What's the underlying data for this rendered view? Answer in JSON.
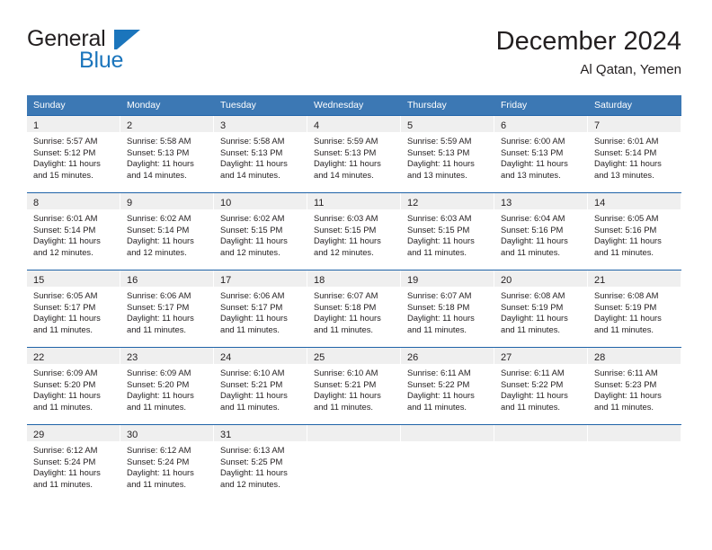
{
  "brand": {
    "name_top": "General",
    "name_bottom": "Blue",
    "accent_color": "#1b75bc",
    "triangle_icon": "brand-triangle-icon"
  },
  "header": {
    "title": "December 2024",
    "subtitle": "Al Qatan, Yemen"
  },
  "theme": {
    "header_row_bg": "#3c78b4",
    "header_row_text": "#ffffff",
    "week_rule": "#1f63a8",
    "daynum_band_bg": "#efefef",
    "body_text": "#231f20"
  },
  "calendar": {
    "weekday_headers": [
      "Sunday",
      "Monday",
      "Tuesday",
      "Wednesday",
      "Thursday",
      "Friday",
      "Saturday"
    ],
    "weeks": [
      [
        {
          "day": "1",
          "sunrise": "Sunrise: 5:57 AM",
          "sunset": "Sunset: 5:12 PM",
          "daylight_line1": "Daylight: 11 hours",
          "daylight_line2": "and 15 minutes."
        },
        {
          "day": "2",
          "sunrise": "Sunrise: 5:58 AM",
          "sunset": "Sunset: 5:13 PM",
          "daylight_line1": "Daylight: 11 hours",
          "daylight_line2": "and 14 minutes."
        },
        {
          "day": "3",
          "sunrise": "Sunrise: 5:58 AM",
          "sunset": "Sunset: 5:13 PM",
          "daylight_line1": "Daylight: 11 hours",
          "daylight_line2": "and 14 minutes."
        },
        {
          "day": "4",
          "sunrise": "Sunrise: 5:59 AM",
          "sunset": "Sunset: 5:13 PM",
          "daylight_line1": "Daylight: 11 hours",
          "daylight_line2": "and 14 minutes."
        },
        {
          "day": "5",
          "sunrise": "Sunrise: 5:59 AM",
          "sunset": "Sunset: 5:13 PM",
          "daylight_line1": "Daylight: 11 hours",
          "daylight_line2": "and 13 minutes."
        },
        {
          "day": "6",
          "sunrise": "Sunrise: 6:00 AM",
          "sunset": "Sunset: 5:13 PM",
          "daylight_line1": "Daylight: 11 hours",
          "daylight_line2": "and 13 minutes."
        },
        {
          "day": "7",
          "sunrise": "Sunrise: 6:01 AM",
          "sunset": "Sunset: 5:14 PM",
          "daylight_line1": "Daylight: 11 hours",
          "daylight_line2": "and 13 minutes."
        }
      ],
      [
        {
          "day": "8",
          "sunrise": "Sunrise: 6:01 AM",
          "sunset": "Sunset: 5:14 PM",
          "daylight_line1": "Daylight: 11 hours",
          "daylight_line2": "and 12 minutes."
        },
        {
          "day": "9",
          "sunrise": "Sunrise: 6:02 AM",
          "sunset": "Sunset: 5:14 PM",
          "daylight_line1": "Daylight: 11 hours",
          "daylight_line2": "and 12 minutes."
        },
        {
          "day": "10",
          "sunrise": "Sunrise: 6:02 AM",
          "sunset": "Sunset: 5:15 PM",
          "daylight_line1": "Daylight: 11 hours",
          "daylight_line2": "and 12 minutes."
        },
        {
          "day": "11",
          "sunrise": "Sunrise: 6:03 AM",
          "sunset": "Sunset: 5:15 PM",
          "daylight_line1": "Daylight: 11 hours",
          "daylight_line2": "and 12 minutes."
        },
        {
          "day": "12",
          "sunrise": "Sunrise: 6:03 AM",
          "sunset": "Sunset: 5:15 PM",
          "daylight_line1": "Daylight: 11 hours",
          "daylight_line2": "and 11 minutes."
        },
        {
          "day": "13",
          "sunrise": "Sunrise: 6:04 AM",
          "sunset": "Sunset: 5:16 PM",
          "daylight_line1": "Daylight: 11 hours",
          "daylight_line2": "and 11 minutes."
        },
        {
          "day": "14",
          "sunrise": "Sunrise: 6:05 AM",
          "sunset": "Sunset: 5:16 PM",
          "daylight_line1": "Daylight: 11 hours",
          "daylight_line2": "and 11 minutes."
        }
      ],
      [
        {
          "day": "15",
          "sunrise": "Sunrise: 6:05 AM",
          "sunset": "Sunset: 5:17 PM",
          "daylight_line1": "Daylight: 11 hours",
          "daylight_line2": "and 11 minutes."
        },
        {
          "day": "16",
          "sunrise": "Sunrise: 6:06 AM",
          "sunset": "Sunset: 5:17 PM",
          "daylight_line1": "Daylight: 11 hours",
          "daylight_line2": "and 11 minutes."
        },
        {
          "day": "17",
          "sunrise": "Sunrise: 6:06 AM",
          "sunset": "Sunset: 5:17 PM",
          "daylight_line1": "Daylight: 11 hours",
          "daylight_line2": "and 11 minutes."
        },
        {
          "day": "18",
          "sunrise": "Sunrise: 6:07 AM",
          "sunset": "Sunset: 5:18 PM",
          "daylight_line1": "Daylight: 11 hours",
          "daylight_line2": "and 11 minutes."
        },
        {
          "day": "19",
          "sunrise": "Sunrise: 6:07 AM",
          "sunset": "Sunset: 5:18 PM",
          "daylight_line1": "Daylight: 11 hours",
          "daylight_line2": "and 11 minutes."
        },
        {
          "day": "20",
          "sunrise": "Sunrise: 6:08 AM",
          "sunset": "Sunset: 5:19 PM",
          "daylight_line1": "Daylight: 11 hours",
          "daylight_line2": "and 11 minutes."
        },
        {
          "day": "21",
          "sunrise": "Sunrise: 6:08 AM",
          "sunset": "Sunset: 5:19 PM",
          "daylight_line1": "Daylight: 11 hours",
          "daylight_line2": "and 11 minutes."
        }
      ],
      [
        {
          "day": "22",
          "sunrise": "Sunrise: 6:09 AM",
          "sunset": "Sunset: 5:20 PM",
          "daylight_line1": "Daylight: 11 hours",
          "daylight_line2": "and 11 minutes."
        },
        {
          "day": "23",
          "sunrise": "Sunrise: 6:09 AM",
          "sunset": "Sunset: 5:20 PM",
          "daylight_line1": "Daylight: 11 hours",
          "daylight_line2": "and 11 minutes."
        },
        {
          "day": "24",
          "sunrise": "Sunrise: 6:10 AM",
          "sunset": "Sunset: 5:21 PM",
          "daylight_line1": "Daylight: 11 hours",
          "daylight_line2": "and 11 minutes."
        },
        {
          "day": "25",
          "sunrise": "Sunrise: 6:10 AM",
          "sunset": "Sunset: 5:21 PM",
          "daylight_line1": "Daylight: 11 hours",
          "daylight_line2": "and 11 minutes."
        },
        {
          "day": "26",
          "sunrise": "Sunrise: 6:11 AM",
          "sunset": "Sunset: 5:22 PM",
          "daylight_line1": "Daylight: 11 hours",
          "daylight_line2": "and 11 minutes."
        },
        {
          "day": "27",
          "sunrise": "Sunrise: 6:11 AM",
          "sunset": "Sunset: 5:22 PM",
          "daylight_line1": "Daylight: 11 hours",
          "daylight_line2": "and 11 minutes."
        },
        {
          "day": "28",
          "sunrise": "Sunrise: 6:11 AM",
          "sunset": "Sunset: 5:23 PM",
          "daylight_line1": "Daylight: 11 hours",
          "daylight_line2": "and 11 minutes."
        }
      ],
      [
        {
          "day": "29",
          "sunrise": "Sunrise: 6:12 AM",
          "sunset": "Sunset: 5:24 PM",
          "daylight_line1": "Daylight: 11 hours",
          "daylight_line2": "and 11 minutes."
        },
        {
          "day": "30",
          "sunrise": "Sunrise: 6:12 AM",
          "sunset": "Sunset: 5:24 PM",
          "daylight_line1": "Daylight: 11 hours",
          "daylight_line2": "and 11 minutes."
        },
        {
          "day": "31",
          "sunrise": "Sunrise: 6:13 AM",
          "sunset": "Sunset: 5:25 PM",
          "daylight_line1": "Daylight: 11 hours",
          "daylight_line2": "and 12 minutes."
        },
        {
          "day": "",
          "sunrise": "",
          "sunset": "",
          "daylight_line1": "",
          "daylight_line2": ""
        },
        {
          "day": "",
          "sunrise": "",
          "sunset": "",
          "daylight_line1": "",
          "daylight_line2": ""
        },
        {
          "day": "",
          "sunrise": "",
          "sunset": "",
          "daylight_line1": "",
          "daylight_line2": ""
        },
        {
          "day": "",
          "sunrise": "",
          "sunset": "",
          "daylight_line1": "",
          "daylight_line2": ""
        }
      ]
    ]
  }
}
